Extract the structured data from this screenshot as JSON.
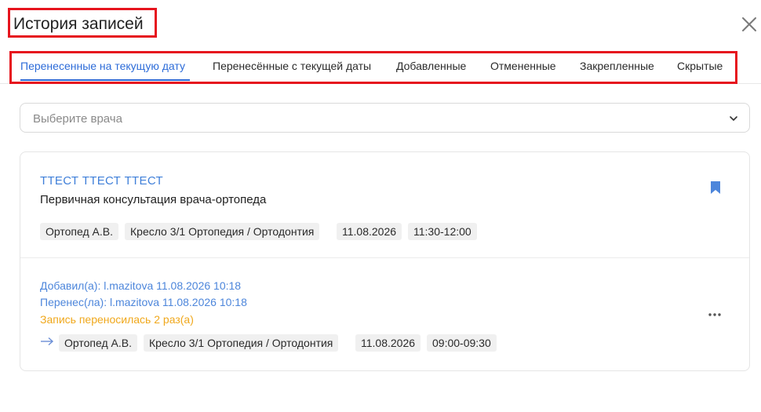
{
  "dialog": {
    "title": "История записей",
    "close_icon": "close-icon"
  },
  "tabs": [
    {
      "label": "Перенесенные на текущую дату",
      "active": true
    },
    {
      "label": "Перенесённые с текущей даты",
      "active": false
    },
    {
      "label": "Добавленные",
      "active": false
    },
    {
      "label": "Отмененные",
      "active": false
    },
    {
      "label": "Закрепленные",
      "active": false
    },
    {
      "label": "Скрытые",
      "active": false
    }
  ],
  "doctor_select": {
    "placeholder": "Выберите врача",
    "icon": "chevron-down-icon"
  },
  "record": {
    "patient_name": "ТТЕСТ ТТЕСТ ТТЕСТ",
    "service": "Первичная консультация врача-ортопеда",
    "bookmark_icon": "bookmark-icon",
    "current_tags": [
      "Ортопед А.В.",
      "Кресло 3/1 Ортопедия / Ортодонтия",
      "11.08.2026",
      "11:30-12:00"
    ],
    "added_by": "Добавил(а): l.mazitova 11.08.2026 10:18",
    "moved_by": "Перенес(ла): l.mazitova 11.08.2026 10:18",
    "moved_count": "Запись переносилась 2 раз(а)",
    "previous_tags": [
      "Ортопед А.В.",
      "Кресло 3/1 Ортопедия / Ортодонтия",
      "11.08.2026",
      "09:00-09:30"
    ],
    "more_icon": "more-horizontal-icon"
  },
  "colors": {
    "accent": "#2c6bd8",
    "link": "#3f7fd9",
    "warning": "#f0a81c",
    "highlight_border": "#e6141e"
  }
}
